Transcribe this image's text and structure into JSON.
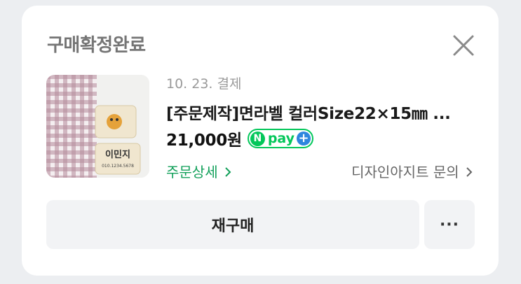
{
  "order": {
    "status_title": "구매확정완료",
    "payment_date": "10. 23. 결제",
    "product_name": "[주문제작]면라벨 컬러Size22×15㎜ ...",
    "price": "21,000원",
    "npay": {
      "logo_letter": "N",
      "text": "pay",
      "plus": "+"
    },
    "order_detail_link": "주문상세",
    "seller_inquiry_link": "디자인아지트 문의",
    "thumbnail": {
      "label_name": "이민지",
      "label_phone": "010.1234.5678"
    }
  },
  "actions": {
    "reorder_label": "재구매",
    "more_label": "···"
  },
  "colors": {
    "background": "#eceef1",
    "card": "#ffffff",
    "npay_green": "#03c75a",
    "detail_green": "#12a05a",
    "plus_blue": "#2e86de",
    "gingham": "#b48a9a"
  },
  "icons": {
    "close": "close-icon",
    "chevron": "chevron-right-icon"
  }
}
